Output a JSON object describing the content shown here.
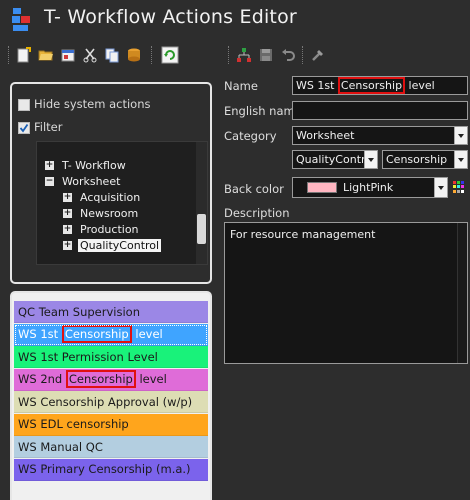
{
  "window": {
    "title": "T- Workflow Actions Editor"
  },
  "toolbar": {
    "buttons": [
      "new-icon",
      "open-icon",
      "properties-icon",
      "cut-icon",
      "copy-icon",
      "database-icon",
      "refresh-icon",
      "tree-icon",
      "save-icon",
      "undo-icon",
      "tools-icon"
    ]
  },
  "filter": {
    "hide_system_actions_label": "Hide system actions",
    "hide_system_actions_checked": false,
    "filter_label": "Filter",
    "filter_checked": true,
    "tree": [
      {
        "label": "T- Workflow",
        "expander": "+"
      },
      {
        "label": "Worksheet",
        "expander": "−"
      },
      {
        "label": "Acquisition",
        "expander": "+"
      },
      {
        "label": "Newsroom",
        "expander": "+"
      },
      {
        "label": "Production",
        "expander": "+"
      },
      {
        "label": "QualityControl",
        "expander": "+"
      }
    ]
  },
  "actions_list": [
    {
      "pre": "QC Team Supervision",
      "hl": "",
      "post": "",
      "color": "#9b87e6"
    },
    {
      "pre": "WS 1st ",
      "hl": "Censorship",
      "post": " level",
      "color": "#3fa4ff"
    },
    {
      "pre": "WS 1st Permission Level",
      "hl": "",
      "post": "",
      "color": "#19f27a"
    },
    {
      "pre": "WS 2nd ",
      "hl": "Censorship",
      "post": " level",
      "color": "#df6cd8"
    },
    {
      "pre": "WS Censorship Approval (w/p)",
      "hl": "",
      "post": "",
      "color": "#ddddb4"
    },
    {
      "pre": "WS EDL censorship",
      "hl": "",
      "post": "",
      "color": "#ffa51c"
    },
    {
      "pre": "WS Manual QC",
      "hl": "",
      "post": "",
      "color": "#b3cee0"
    },
    {
      "pre": "WS Primary Censorship (m.a.)",
      "hl": "",
      "post": "",
      "color": "#7b63ec"
    }
  ],
  "form": {
    "name_label": "Name",
    "name_pre": "WS 1st ",
    "name_hl": "Censorship",
    "name_post": " level",
    "english_name_label": "English name",
    "english_name_value": "",
    "category_label": "Category",
    "category_value": "Worksheet",
    "subcategory_value": "QualityContro",
    "subcategory2_value": "Censorship",
    "back_color_label": "Back color",
    "back_color_value": "LightPink",
    "back_color_hex": "#ffb6c1",
    "description_label": "Description",
    "description_value": "For resource management"
  }
}
